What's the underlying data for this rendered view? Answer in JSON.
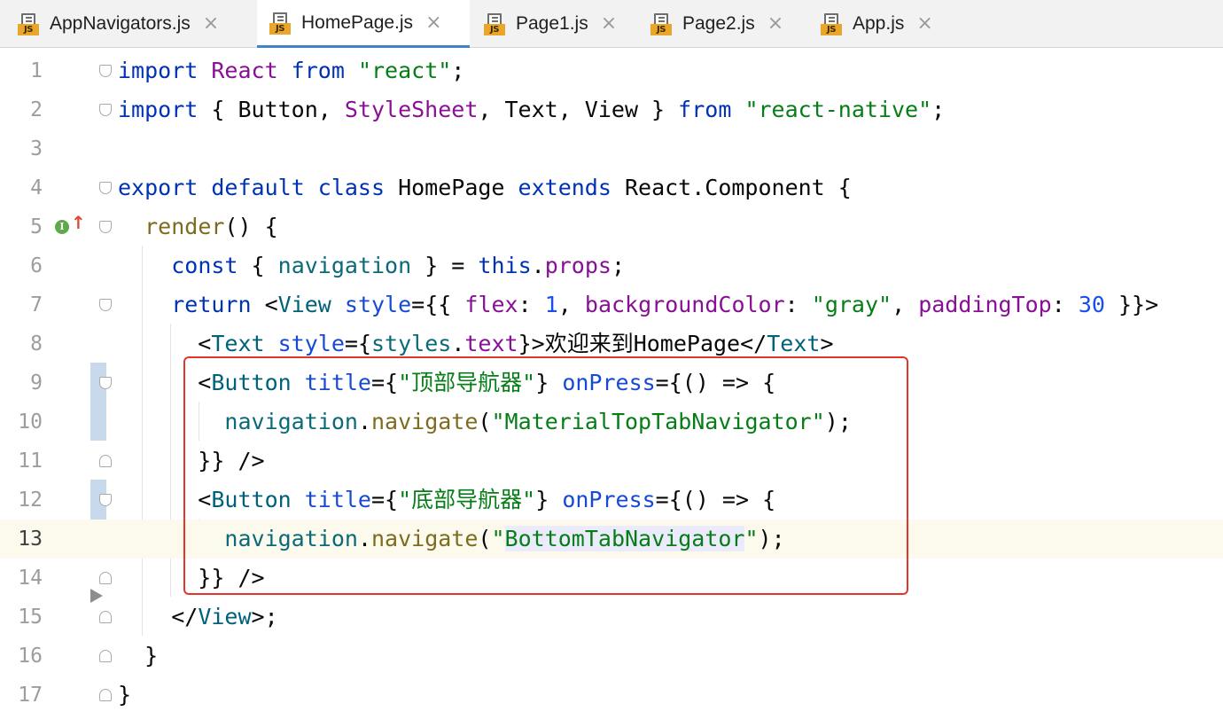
{
  "tabs": [
    {
      "label": "AppNavigators.js",
      "active": false,
      "closable": true
    },
    {
      "label": "HomePage.js",
      "active": true,
      "closable": true
    },
    {
      "label": "Page1.js",
      "active": false,
      "closable": true
    },
    {
      "label": "Page2.js",
      "active": false,
      "closable": true
    },
    {
      "label": "App.js",
      "active": false,
      "closable": true
    }
  ],
  "icons": {
    "file_badge": "JS",
    "close": "×",
    "implements_badge": "I",
    "implements_arrow": "↑"
  },
  "colors": {
    "active_tab_underline": "#4083c9",
    "highlight_box": "#e5342e",
    "current_line": "#fcfaed"
  },
  "editor": {
    "current_line": 13,
    "line_numbers": [
      "1",
      "2",
      "3",
      "4",
      "5",
      "6",
      "7",
      "8",
      "9",
      "10",
      "11",
      "12",
      "13",
      "14",
      "15",
      "16",
      "17"
    ],
    "lines": [
      [
        {
          "t": "import ",
          "c": "k"
        },
        {
          "t": "React ",
          "c": "p"
        },
        {
          "t": "from ",
          "c": "k"
        },
        {
          "t": "\"react\"",
          "c": "s"
        },
        {
          "t": ";"
        }
      ],
      [
        {
          "t": "import ",
          "c": "k"
        },
        {
          "t": "{ Button, "
        },
        {
          "t": "StyleSheet",
          "c": "p"
        },
        {
          "t": ", Text, View } "
        },
        {
          "t": "from ",
          "c": "k"
        },
        {
          "t": "\"react-native\"",
          "c": "s"
        },
        {
          "t": ";"
        }
      ],
      [],
      [
        {
          "t": "export default class ",
          "c": "k"
        },
        {
          "t": "HomePage "
        },
        {
          "t": "extends ",
          "c": "k"
        },
        {
          "t": "React.Component {"
        }
      ],
      [
        {
          "t": "  "
        },
        {
          "t": "render",
          "c": "fn"
        },
        {
          "t": "() {"
        }
      ],
      [
        {
          "t": "    "
        },
        {
          "t": "const ",
          "c": "k"
        },
        {
          "t": "{ "
        },
        {
          "t": "navigation",
          "c": "nv"
        },
        {
          "t": " } = "
        },
        {
          "t": "this",
          "c": "k"
        },
        {
          "t": "."
        },
        {
          "t": "props",
          "c": "p"
        },
        {
          "t": ";"
        }
      ],
      [
        {
          "t": "    "
        },
        {
          "t": "return ",
          "c": "k"
        },
        {
          "t": "<"
        },
        {
          "t": "View ",
          "c": "t"
        },
        {
          "t": "style",
          "c": "a"
        },
        {
          "t": "={{ "
        },
        {
          "t": "flex",
          "c": "p"
        },
        {
          "t": ": "
        },
        {
          "t": "1",
          "c": "n"
        },
        {
          "t": ", "
        },
        {
          "t": "backgroundColor",
          "c": "p"
        },
        {
          "t": ": "
        },
        {
          "t": "\"gray\"",
          "c": "s"
        },
        {
          "t": ", "
        },
        {
          "t": "paddingTop",
          "c": "p"
        },
        {
          "t": ": "
        },
        {
          "t": "30",
          "c": "n"
        },
        {
          "t": " }}>"
        }
      ],
      [
        {
          "t": "      <"
        },
        {
          "t": "Text ",
          "c": "t"
        },
        {
          "t": "style",
          "c": "a"
        },
        {
          "t": "={"
        },
        {
          "t": "styles",
          "c": "nv"
        },
        {
          "t": "."
        },
        {
          "t": "text",
          "c": "p"
        },
        {
          "t": "}>欢迎来到HomePage</"
        },
        {
          "t": "Text",
          "c": "t"
        },
        {
          "t": ">"
        }
      ],
      [
        {
          "t": "      <"
        },
        {
          "t": "Button ",
          "c": "t"
        },
        {
          "t": "title",
          "c": "a"
        },
        {
          "t": "={"
        },
        {
          "t": "\"顶部导航器\"",
          "c": "s"
        },
        {
          "t": "} "
        },
        {
          "t": "onPress",
          "c": "a"
        },
        {
          "t": "={() => {"
        }
      ],
      [
        {
          "t": "        "
        },
        {
          "t": "navigation",
          "c": "nv"
        },
        {
          "t": "."
        },
        {
          "t": "navigate",
          "c": "fn"
        },
        {
          "t": "("
        },
        {
          "t": "\"MaterialTopTabNavigator\"",
          "c": "s"
        },
        {
          "t": ");"
        }
      ],
      [
        {
          "t": "      }} />"
        }
      ],
      [
        {
          "t": "      <"
        },
        {
          "t": "Button ",
          "c": "t"
        },
        {
          "t": "title",
          "c": "a"
        },
        {
          "t": "={"
        },
        {
          "t": "\"底部导航器\"",
          "c": "s"
        },
        {
          "t": "} "
        },
        {
          "t": "onPress",
          "c": "a"
        },
        {
          "t": "={() => {"
        }
      ],
      [
        {
          "t": "        "
        },
        {
          "t": "navigation",
          "c": "nv"
        },
        {
          "t": "."
        },
        {
          "t": "navigate",
          "c": "fn"
        },
        {
          "t": "("
        },
        {
          "t": "\"",
          "c": "s"
        },
        {
          "t": "BottomTabNavigator",
          "c": "s hl"
        },
        {
          "t": "\"",
          "c": "s"
        },
        {
          "t": ");"
        }
      ],
      [
        {
          "t": "      }} />"
        }
      ],
      [
        {
          "t": "    </"
        },
        {
          "t": "View",
          "c": "t"
        },
        {
          "t": ">;"
        }
      ],
      [
        {
          "t": "  }"
        }
      ],
      [
        {
          "t": "}"
        }
      ]
    ]
  }
}
